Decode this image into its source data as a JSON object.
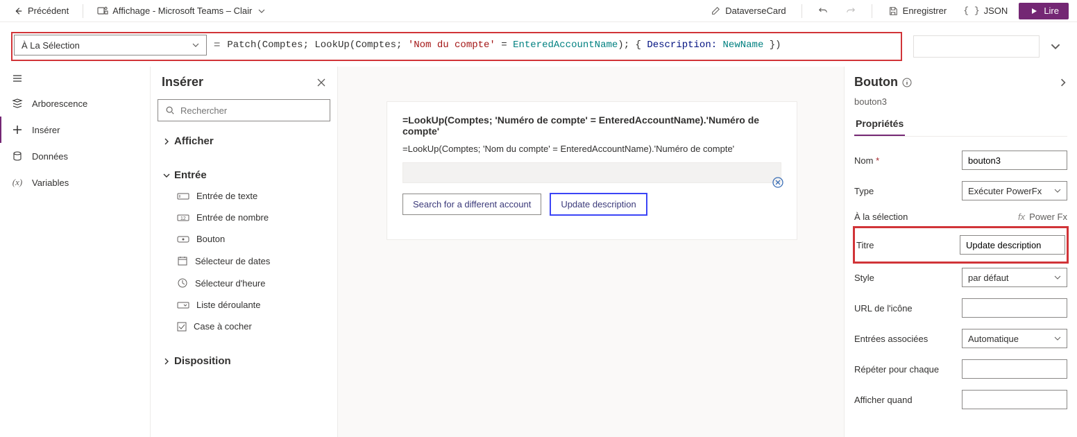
{
  "topbar": {
    "back": "Précédent",
    "theme": "Affichage - Microsoft Teams – Clair",
    "dataverse": "DataverseCard",
    "save": "Enregistrer",
    "json": "JSON",
    "play": "Lire"
  },
  "formulabar": {
    "property": "À La Sélection",
    "fn1": "Patch",
    "arg1a": "(Comptes; ",
    "fn2": "LookUp",
    "arg2a": "(Comptes; ",
    "str1": "'Nom du compte'",
    "eq": " = ",
    "var1": "EnteredAccountName",
    "close1": "); { ",
    "prop1": "Description: ",
    "var2": "NewName",
    "close2": " })"
  },
  "nav": {
    "tree": "Arborescence",
    "insert": "Insérer",
    "data": "Données",
    "vars": "Variables"
  },
  "insert": {
    "title": "Insérer",
    "search_ph": "Rechercher",
    "section_display": "Afficher",
    "section_input": "Entrée",
    "section_layout": "Disposition",
    "items": {
      "text": "Entrée de texte",
      "number": "Entrée de nombre",
      "button": "Bouton",
      "date": "Sélecteur de dates",
      "time": "Sélecteur d'heure",
      "dropdown": "Liste déroulante",
      "checkbox": "Case à cocher"
    }
  },
  "canvas": {
    "line1": "=LookUp(Comptes; 'Numéro de compte' = EnteredAccountName).'Numéro de compte'",
    "line2": "=LookUp(Comptes; 'Nom du compte' = EnteredAccountName).'Numéro de compte'",
    "btn_search": "Search for a different account",
    "btn_update": "Update description"
  },
  "props": {
    "header": "Bouton",
    "elname": "bouton3",
    "tab_props": "Propriétés",
    "rows": {
      "name_lbl": "Nom",
      "name_val": "bouton3",
      "type_lbl": "Type",
      "type_val": "Exécuter PowerFx",
      "onselect_lbl": "À la sélection",
      "onselect_val": "Power Fx",
      "title_lbl": "Titre",
      "title_val": "Update description",
      "style_lbl": "Style",
      "style_val": "par défaut",
      "iconurl_lbl": "URL de l'icône",
      "assoc_lbl": "Entrées associées",
      "assoc_val": "Automatique",
      "repeat_lbl": "Répéter pour chaque",
      "showwhen_lbl": "Afficher quand"
    }
  }
}
